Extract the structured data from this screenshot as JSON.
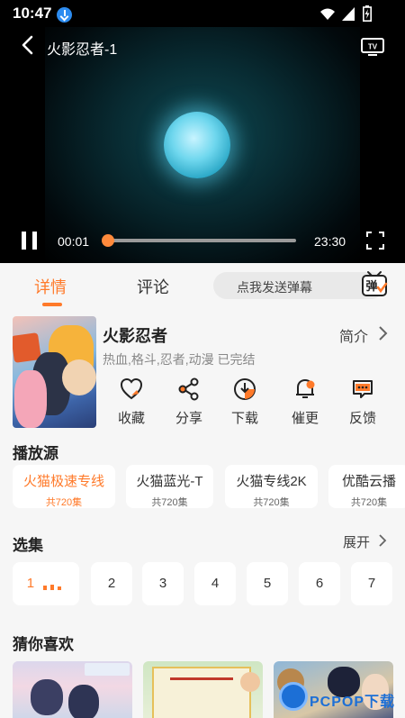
{
  "status": {
    "time": "10:47"
  },
  "player": {
    "title": "火影忍者-1",
    "current_time": "00:01",
    "total_time": "23:30",
    "progress": 0.01,
    "accent": "#ff8a3c"
  },
  "tabs": [
    {
      "label": "详情",
      "active": true
    },
    {
      "label": "评论",
      "active": false
    }
  ],
  "danmaku": {
    "placeholder": "点我发送弹幕",
    "button_label": "弹"
  },
  "anime": {
    "title": "火影忍者",
    "tags": "热血,格斗,忍者,动漫 已完结",
    "intro_label": "简介"
  },
  "actions": [
    {
      "label": "收藏",
      "icon": "heart-icon"
    },
    {
      "label": "分享",
      "icon": "share-icon"
    },
    {
      "label": "下载",
      "icon": "download-icon"
    },
    {
      "label": "催更",
      "icon": "bell-icon"
    },
    {
      "label": "反馈",
      "icon": "feedback-icon"
    }
  ],
  "sources_section": {
    "title": "播放源",
    "items": [
      {
        "name": "火猫极速专线",
        "count": "共720集",
        "active": true
      },
      {
        "name": "火猫蓝光-T",
        "count": "共720集",
        "active": false
      },
      {
        "name": "火猫专线2K",
        "count": "共720集",
        "active": false
      },
      {
        "name": "优酷云播",
        "count": "共720集",
        "active": false
      }
    ]
  },
  "episodes_section": {
    "title": "选集",
    "expand_label": "展开",
    "items": [
      "1",
      "2",
      "3",
      "4",
      "5",
      "6",
      "7"
    ]
  },
  "recommend_section": {
    "title": "猜你喜欢"
  },
  "watermark": {
    "text": "PCPOP下载"
  },
  "colors": {
    "accent": "#ff7a2a",
    "background": "#f6f6f6"
  }
}
